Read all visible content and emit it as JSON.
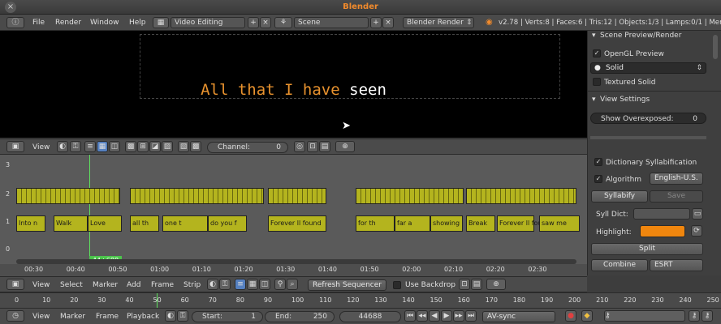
{
  "window": {
    "title": "Blender"
  },
  "menubar": {
    "file": "File",
    "render": "Render",
    "window": "Window",
    "help": "Help",
    "layout": "Video Editing",
    "scene": "Scene",
    "engine": "Blender Render",
    "stats": "v2.78 | Verts:8 | Faces:6 | Tris:12 | Objects:1/3 | Lamps:0/1 | Mem:105"
  },
  "preview": {
    "subtitle_highlight": "All that I have",
    "subtitle_rest": " seen",
    "highlight_color": "#e8922e"
  },
  "preview_header": {
    "view": "View",
    "channel_label": "Channel:",
    "channel_value": "0"
  },
  "sequencer": {
    "channels": [
      "3",
      "2",
      "1",
      "0"
    ],
    "playhead": "44+688",
    "ticks": [
      "00:30",
      "00:40",
      "00:50",
      "01:00",
      "01:10",
      "01:20",
      "01:30",
      "01:40",
      "01:50",
      "02:00",
      "02:10",
      "02:20",
      "02:30"
    ],
    "strips_row1": [
      {
        "label": ""
      },
      {
        "label": ""
      },
      {
        "label": ""
      },
      {
        "label": ""
      },
      {
        "label": ""
      },
      {
        "label": ""
      }
    ],
    "strips_row2": [
      {
        "label": "Into n"
      },
      {
        "label": "Walk"
      },
      {
        "label": "Love"
      },
      {
        "label": "all th"
      },
      {
        "label": "one t"
      },
      {
        "label": "do you f"
      },
      {
        "label": "Forever ll found"
      },
      {
        "label": "for th"
      },
      {
        "label": "far a"
      },
      {
        "label": "showing"
      },
      {
        "label": "Break"
      },
      {
        "label": "Forever ll fou"
      },
      {
        "label": "saw me"
      }
    ]
  },
  "seq_header": {
    "view": "View",
    "select": "Select",
    "marker": "Marker",
    "add": "Add",
    "frame": "Frame",
    "strip": "Strip",
    "refresh": "Refresh Sequencer",
    "backdrop": "Use Backdrop"
  },
  "panel": {
    "scene_preview": "Scene Preview/Render",
    "opengl": "OpenGL Preview",
    "shading": "Solid",
    "textured": "Textured Solid",
    "view_settings": "View Settings",
    "overexposed_label": "Show Overexposed:",
    "overexposed_value": "0",
    "dict_syll": "Dictionary Syllabification",
    "algorithm_label": "Algorithm",
    "algorithm_value": "English-U.S.",
    "syllabify": "Syllabify",
    "save": "Save",
    "syll_dict": "Syll Dict:",
    "highlight": "Highlight:",
    "highlight_color": "#f0860e",
    "split": "Split",
    "combine": "Combine",
    "combine_value": "ESRT"
  },
  "timeline": {
    "ticks": [
      "0",
      "10",
      "20",
      "30",
      "40",
      "50",
      "60",
      "70",
      "80",
      "90",
      "100",
      "110",
      "120",
      "130",
      "140",
      "150",
      "160",
      "170",
      "180",
      "190",
      "200",
      "210",
      "220",
      "230",
      "240",
      "250"
    ]
  },
  "timeline_header": {
    "view": "View",
    "marker": "Marker",
    "frame": "Frame",
    "playback": "Playback",
    "start_label": "Start:",
    "start_value": "1",
    "end_label": "End:",
    "end_value": "250",
    "current": "44688",
    "sync": "AV-sync"
  }
}
